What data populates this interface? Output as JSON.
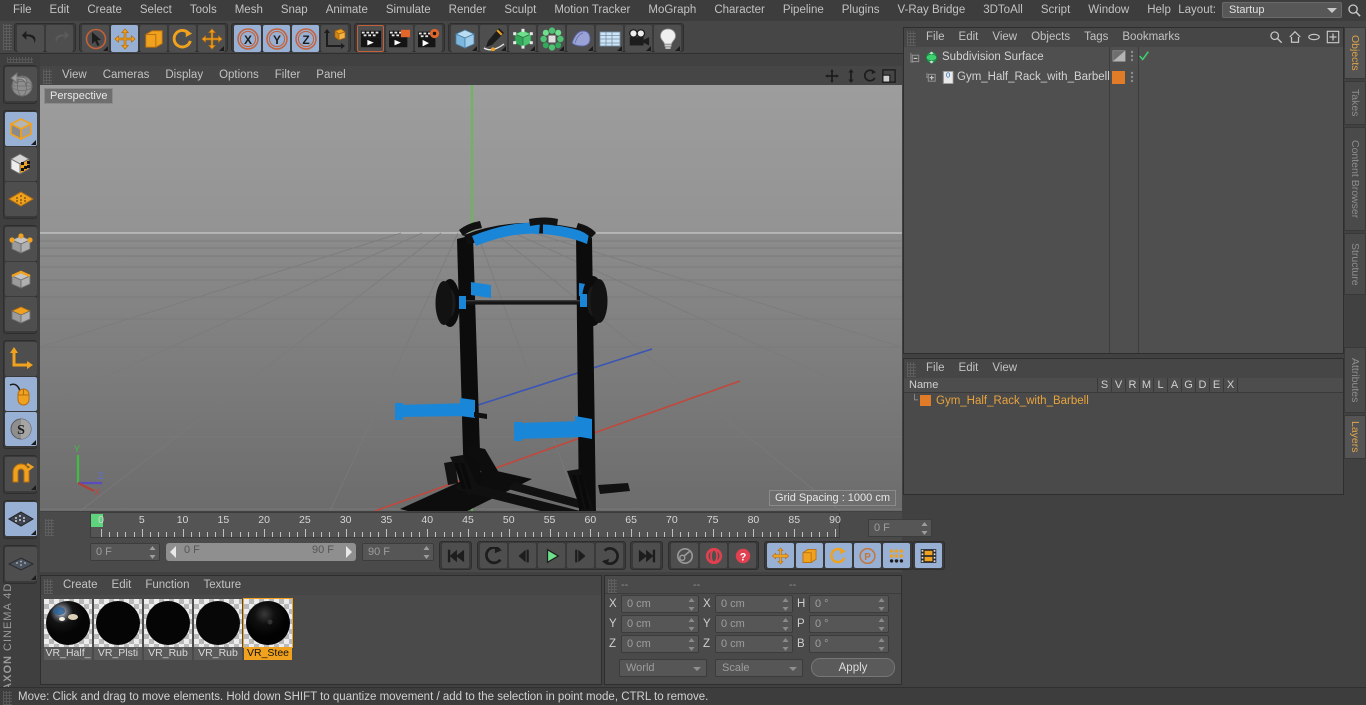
{
  "menubar": {
    "items": [
      "File",
      "Edit",
      "Create",
      "Select",
      "Tools",
      "Mesh",
      "Snap",
      "Animate",
      "Simulate",
      "Render",
      "Sculpt",
      "Motion Tracker",
      "MoGraph",
      "Character",
      "Pipeline",
      "Plugins",
      "V-Ray Bridge",
      "3DToAll",
      "Script",
      "Window",
      "Help"
    ],
    "layout_label": "Layout:",
    "layout_value": "Startup",
    "search_icon": "magnifier-icon"
  },
  "toolbar": {
    "groups": [
      {
        "name": "history",
        "buttons": [
          {
            "icon": "undo-icon",
            "selected": false
          },
          {
            "icon": "redo-icon",
            "selected": false,
            "disabled": true
          }
        ]
      },
      {
        "name": "modes",
        "buttons": [
          {
            "icon": "select-live-icon",
            "selected": false,
            "corner": true
          },
          {
            "icon": "move-icon",
            "selected": true
          },
          {
            "icon": "scale-icon",
            "selected": false
          },
          {
            "icon": "rotate-icon",
            "selected": false
          },
          {
            "icon": "move-dyn-icon",
            "selected": false,
            "corner": true
          }
        ]
      },
      {
        "name": "axes",
        "buttons": [
          {
            "icon": "axis-x-icon",
            "selected": true
          },
          {
            "icon": "axis-y-icon",
            "selected": true
          },
          {
            "icon": "axis-z-icon",
            "selected": true
          },
          {
            "icon": "world-object-axis-icon",
            "selected": false
          }
        ]
      },
      {
        "name": "render",
        "buttons": [
          {
            "icon": "render-view-icon",
            "selected": false,
            "active": true
          },
          {
            "icon": "render-region-icon",
            "selected": false
          },
          {
            "icon": "render-settings-icon",
            "selected": false
          }
        ]
      },
      {
        "name": "objects",
        "buttons": [
          {
            "icon": "cube-primitive-icon",
            "selected": false,
            "corner": true
          },
          {
            "icon": "spline-pen-icon",
            "selected": false,
            "corner": true
          },
          {
            "icon": "generator-icon",
            "selected": false,
            "corner": true
          },
          {
            "icon": "array-icon",
            "selected": false,
            "corner": true
          },
          {
            "icon": "deformer-icon",
            "selected": false,
            "corner": true
          },
          {
            "icon": "scene-floor-icon",
            "selected": false,
            "corner": true
          },
          {
            "icon": "camera-icon",
            "selected": false,
            "corner": true
          },
          {
            "icon": "light-icon",
            "selected": false,
            "corner": true
          }
        ]
      }
    ]
  },
  "leftbar": {
    "groups": [
      {
        "buttons": [
          {
            "icon": "undo-view-icon",
            "selected": false
          }
        ]
      },
      {
        "buttons": [
          {
            "icon": "model-mode-icon",
            "selected": true,
            "corner": true
          },
          {
            "icon": "texture-mode-icon",
            "selected": false
          },
          {
            "icon": "workplane-icon",
            "selected": false
          }
        ]
      },
      {
        "buttons": [
          {
            "icon": "points-mode-icon",
            "selected": false
          },
          {
            "icon": "edges-mode-icon",
            "selected": false
          },
          {
            "icon": "polygons-mode-icon",
            "selected": false
          }
        ]
      },
      {
        "buttons": [
          {
            "icon": "axis-modify-icon",
            "selected": false
          },
          {
            "icon": "viewport-solo-mouse-icon",
            "selected": true
          },
          {
            "icon": "enable-axis-icon",
            "selected": true,
            "corner": true
          }
        ]
      },
      {
        "buttons": [
          {
            "icon": "magnet-icon",
            "selected": false,
            "corner": true
          }
        ]
      },
      {
        "buttons": [
          {
            "icon": "workplane-lock-icon",
            "selected": true,
            "corner": true
          }
        ]
      },
      {
        "buttons": [
          {
            "icon": "workplane-grid-icon",
            "selected": false,
            "corner": true
          }
        ]
      }
    ],
    "brand_top": "MAXON",
    "brand_bottom": "CINEMA 4D"
  },
  "viewport": {
    "menu": [
      "View",
      "Cameras",
      "Display",
      "Options",
      "Filter",
      "Panel"
    ],
    "corner_icons": [
      "pan-icon",
      "dolly-icon",
      "orbit-icon",
      "maximize-icon"
    ],
    "label": "Perspective",
    "grid_spacing": "Grid Spacing : 1000 cm",
    "axis_gizmo": {
      "y": "Y",
      "z": "Z",
      "x": "X"
    }
  },
  "object_manager": {
    "menu": [
      "File",
      "Edit",
      "View",
      "Objects",
      "Tags",
      "Bookmarks"
    ],
    "header_icons": [
      "search-icon",
      "home-icon",
      "ellipse-icon",
      "add-layer-icon"
    ],
    "items": [
      {
        "name": "Subdivision Surface",
        "icon": "subdivision-surface-icon",
        "indent": 0,
        "expander": "minus",
        "tag": "display-tag",
        "check": true
      },
      {
        "name": "Gym_Half_Rack_with_Barbell",
        "icon": "layer-0-icon",
        "indent": 1,
        "expander": "plus",
        "tag": "material-tag",
        "check": false
      }
    ]
  },
  "layer_manager": {
    "menu": [
      "File",
      "Edit",
      "View"
    ],
    "columns": [
      "Name",
      "S",
      "V",
      "R",
      "M",
      "L",
      "A",
      "G",
      "D",
      "E",
      "X"
    ],
    "rows": [
      {
        "name": "Gym_Half_Rack_with_Barbell",
        "color": "#e08a2c"
      }
    ]
  },
  "right_tabs": [
    {
      "label": "Objects",
      "active": true
    },
    {
      "label": "Takes",
      "active": false
    },
    {
      "label": "Content Browser",
      "active": false
    },
    {
      "label": "Structure",
      "active": false
    },
    {
      "label": "Attributes",
      "active": false
    },
    {
      "label": "Layers",
      "active": true
    }
  ],
  "timeline": {
    "tick_labels": [
      "0",
      "5",
      "10",
      "15",
      "20",
      "25",
      "30",
      "35",
      "40",
      "45",
      "50",
      "55",
      "60",
      "65",
      "70",
      "75",
      "80",
      "85",
      "90"
    ],
    "current_frame_right": "0 F",
    "current_frame_left": "0 F",
    "range_start": "0 F",
    "range_end": "90 F",
    "preview_end": "90 F",
    "transport": [
      {
        "icon": "go-to-start-icon"
      },
      {
        "icon": "step-back-key-icon"
      },
      {
        "icon": "step-back-frame-icon"
      },
      {
        "icon": "play-icon",
        "selected": false
      },
      {
        "icon": "step-forward-frame-icon"
      },
      {
        "icon": "step-forward-key-icon"
      },
      {
        "icon": "go-to-end-icon"
      }
    ],
    "record_group": [
      {
        "icon": "record-key-icon"
      },
      {
        "icon": "autokey-icon"
      },
      {
        "icon": "keyframe-selection-icon"
      }
    ],
    "key_attr_group": [
      {
        "icon": "key-position-icon",
        "selected": true
      },
      {
        "icon": "key-scale-icon",
        "selected": true
      },
      {
        "icon": "key-rotation-icon",
        "selected": true
      },
      {
        "icon": "key-param-icon",
        "selected": true
      },
      {
        "icon": "key-pla-icon",
        "selected": true
      }
    ],
    "last_group": [
      {
        "icon": "timeline-icon",
        "selected": true
      }
    ]
  },
  "material_manager": {
    "menu": [
      "Create",
      "Edit",
      "Function",
      "Texture"
    ],
    "materials": [
      {
        "name": "VR_Half_",
        "selected": false,
        "swatch": "chrome"
      },
      {
        "name": "VR_Plsti",
        "selected": false,
        "swatch": "black"
      },
      {
        "name": "VR_Rub",
        "selected": false,
        "swatch": "black"
      },
      {
        "name": "VR_Rub",
        "selected": false,
        "swatch": "black"
      },
      {
        "name": "VR_Stee",
        "selected": true,
        "swatch": "darkmetal"
      }
    ]
  },
  "coordinate_manager": {
    "headers": [
      "--",
      "--",
      "--"
    ],
    "rows": [
      {
        "l1": "X",
        "v1": "0 cm",
        "l2": "X",
        "v2": "0 cm",
        "l3": "H",
        "v3": "0 °"
      },
      {
        "l1": "Y",
        "v1": "0 cm",
        "l2": "Y",
        "v2": "0 cm",
        "l3": "P",
        "v3": "0 °"
      },
      {
        "l1": "Z",
        "v1": "0 cm",
        "l2": "Z",
        "v2": "0 cm",
        "l3": "B",
        "v3": "0 °"
      }
    ],
    "system": "World",
    "mode": "Scale",
    "apply": "Apply"
  },
  "statusbar": {
    "message": "Move: Click and drag to move elements. Hold down SHIFT to quantize movement / add to the selection in point mode, CTRL to remove."
  },
  "colors": {
    "accent_orange": "#f0a11e",
    "selected_blue": "#97b0d4",
    "panel_bg": "#4a4a4a",
    "model_blue": "#1a86d8"
  }
}
